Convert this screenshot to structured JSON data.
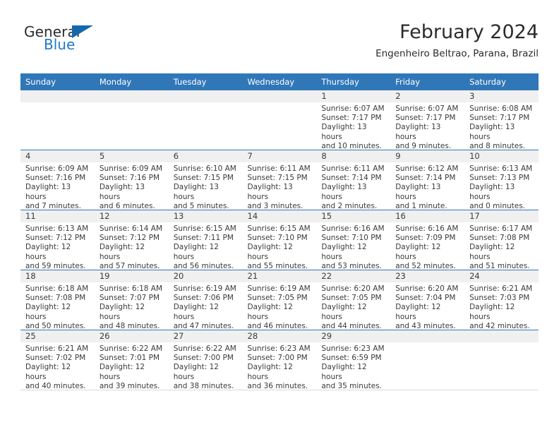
{
  "brand": {
    "word_general": "General",
    "word_blue": "Blue",
    "triangle_color": "#1668ad",
    "blue_text_color": "#1f7ac4"
  },
  "header": {
    "title": "February 2024",
    "subtitle": "Engenheiro Beltrao, Parana, Brazil",
    "header_bg": "#3077b8",
    "daynum_bg": "#f0f0f0"
  },
  "weekdays": [
    "Sunday",
    "Monday",
    "Tuesday",
    "Wednesday",
    "Thursday",
    "Friday",
    "Saturday"
  ],
  "weeks": [
    [
      {
        "day": "",
        "empty": true,
        "sunrise": "",
        "sunset": "",
        "daylight_a": "",
        "daylight_b": ""
      },
      {
        "day": "",
        "empty": true,
        "sunrise": "",
        "sunset": "",
        "daylight_a": "",
        "daylight_b": ""
      },
      {
        "day": "",
        "empty": true,
        "sunrise": "",
        "sunset": "",
        "daylight_a": "",
        "daylight_b": ""
      },
      {
        "day": "",
        "empty": true,
        "sunrise": "",
        "sunset": "",
        "daylight_a": "",
        "daylight_b": ""
      },
      {
        "day": "1",
        "empty": false,
        "sunrise": "Sunrise: 6:07 AM",
        "sunset": "Sunset: 7:17 PM",
        "daylight_a": "Daylight: 13 hours",
        "daylight_b": "and 10 minutes."
      },
      {
        "day": "2",
        "empty": false,
        "sunrise": "Sunrise: 6:07 AM",
        "sunset": "Sunset: 7:17 PM",
        "daylight_a": "Daylight: 13 hours",
        "daylight_b": "and 9 minutes."
      },
      {
        "day": "3",
        "empty": false,
        "sunrise": "Sunrise: 6:08 AM",
        "sunset": "Sunset: 7:17 PM",
        "daylight_a": "Daylight: 13 hours",
        "daylight_b": "and 8 minutes."
      }
    ],
    [
      {
        "day": "4",
        "empty": false,
        "sunrise": "Sunrise: 6:09 AM",
        "sunset": "Sunset: 7:16 PM",
        "daylight_a": "Daylight: 13 hours",
        "daylight_b": "and 7 minutes."
      },
      {
        "day": "5",
        "empty": false,
        "sunrise": "Sunrise: 6:09 AM",
        "sunset": "Sunset: 7:16 PM",
        "daylight_a": "Daylight: 13 hours",
        "daylight_b": "and 6 minutes."
      },
      {
        "day": "6",
        "empty": false,
        "sunrise": "Sunrise: 6:10 AM",
        "sunset": "Sunset: 7:15 PM",
        "daylight_a": "Daylight: 13 hours",
        "daylight_b": "and 5 minutes."
      },
      {
        "day": "7",
        "empty": false,
        "sunrise": "Sunrise: 6:11 AM",
        "sunset": "Sunset: 7:15 PM",
        "daylight_a": "Daylight: 13 hours",
        "daylight_b": "and 3 minutes."
      },
      {
        "day": "8",
        "empty": false,
        "sunrise": "Sunrise: 6:11 AM",
        "sunset": "Sunset: 7:14 PM",
        "daylight_a": "Daylight: 13 hours",
        "daylight_b": "and 2 minutes."
      },
      {
        "day": "9",
        "empty": false,
        "sunrise": "Sunrise: 6:12 AM",
        "sunset": "Sunset: 7:14 PM",
        "daylight_a": "Daylight: 13 hours",
        "daylight_b": "and 1 minute."
      },
      {
        "day": "10",
        "empty": false,
        "sunrise": "Sunrise: 6:13 AM",
        "sunset": "Sunset: 7:13 PM",
        "daylight_a": "Daylight: 13 hours",
        "daylight_b": "and 0 minutes."
      }
    ],
    [
      {
        "day": "11",
        "empty": false,
        "sunrise": "Sunrise: 6:13 AM",
        "sunset": "Sunset: 7:12 PM",
        "daylight_a": "Daylight: 12 hours",
        "daylight_b": "and 59 minutes."
      },
      {
        "day": "12",
        "empty": false,
        "sunrise": "Sunrise: 6:14 AM",
        "sunset": "Sunset: 7:12 PM",
        "daylight_a": "Daylight: 12 hours",
        "daylight_b": "and 57 minutes."
      },
      {
        "day": "13",
        "empty": false,
        "sunrise": "Sunrise: 6:15 AM",
        "sunset": "Sunset: 7:11 PM",
        "daylight_a": "Daylight: 12 hours",
        "daylight_b": "and 56 minutes."
      },
      {
        "day": "14",
        "empty": false,
        "sunrise": "Sunrise: 6:15 AM",
        "sunset": "Sunset: 7:10 PM",
        "daylight_a": "Daylight: 12 hours",
        "daylight_b": "and 55 minutes."
      },
      {
        "day": "15",
        "empty": false,
        "sunrise": "Sunrise: 6:16 AM",
        "sunset": "Sunset: 7:10 PM",
        "daylight_a": "Daylight: 12 hours",
        "daylight_b": "and 53 minutes."
      },
      {
        "day": "16",
        "empty": false,
        "sunrise": "Sunrise: 6:16 AM",
        "sunset": "Sunset: 7:09 PM",
        "daylight_a": "Daylight: 12 hours",
        "daylight_b": "and 52 minutes."
      },
      {
        "day": "17",
        "empty": false,
        "sunrise": "Sunrise: 6:17 AM",
        "sunset": "Sunset: 7:08 PM",
        "daylight_a": "Daylight: 12 hours",
        "daylight_b": "and 51 minutes."
      }
    ],
    [
      {
        "day": "18",
        "empty": false,
        "sunrise": "Sunrise: 6:18 AM",
        "sunset": "Sunset: 7:08 PM",
        "daylight_a": "Daylight: 12 hours",
        "daylight_b": "and 50 minutes."
      },
      {
        "day": "19",
        "empty": false,
        "sunrise": "Sunrise: 6:18 AM",
        "sunset": "Sunset: 7:07 PM",
        "daylight_a": "Daylight: 12 hours",
        "daylight_b": "and 48 minutes."
      },
      {
        "day": "20",
        "empty": false,
        "sunrise": "Sunrise: 6:19 AM",
        "sunset": "Sunset: 7:06 PM",
        "daylight_a": "Daylight: 12 hours",
        "daylight_b": "and 47 minutes."
      },
      {
        "day": "21",
        "empty": false,
        "sunrise": "Sunrise: 6:19 AM",
        "sunset": "Sunset: 7:05 PM",
        "daylight_a": "Daylight: 12 hours",
        "daylight_b": "and 46 minutes."
      },
      {
        "day": "22",
        "empty": false,
        "sunrise": "Sunrise: 6:20 AM",
        "sunset": "Sunset: 7:05 PM",
        "daylight_a": "Daylight: 12 hours",
        "daylight_b": "and 44 minutes."
      },
      {
        "day": "23",
        "empty": false,
        "sunrise": "Sunrise: 6:20 AM",
        "sunset": "Sunset: 7:04 PM",
        "daylight_a": "Daylight: 12 hours",
        "daylight_b": "and 43 minutes."
      },
      {
        "day": "24",
        "empty": false,
        "sunrise": "Sunrise: 6:21 AM",
        "sunset": "Sunset: 7:03 PM",
        "daylight_a": "Daylight: 12 hours",
        "daylight_b": "and 42 minutes."
      }
    ],
    [
      {
        "day": "25",
        "empty": false,
        "sunrise": "Sunrise: 6:21 AM",
        "sunset": "Sunset: 7:02 PM",
        "daylight_a": "Daylight: 12 hours",
        "daylight_b": "and 40 minutes."
      },
      {
        "day": "26",
        "empty": false,
        "sunrise": "Sunrise: 6:22 AM",
        "sunset": "Sunset: 7:01 PM",
        "daylight_a": "Daylight: 12 hours",
        "daylight_b": "and 39 minutes."
      },
      {
        "day": "27",
        "empty": false,
        "sunrise": "Sunrise: 6:22 AM",
        "sunset": "Sunset: 7:00 PM",
        "daylight_a": "Daylight: 12 hours",
        "daylight_b": "and 38 minutes."
      },
      {
        "day": "28",
        "empty": false,
        "sunrise": "Sunrise: 6:23 AM",
        "sunset": "Sunset: 7:00 PM",
        "daylight_a": "Daylight: 12 hours",
        "daylight_b": "and 36 minutes."
      },
      {
        "day": "29",
        "empty": false,
        "sunrise": "Sunrise: 6:23 AM",
        "sunset": "Sunset: 6:59 PM",
        "daylight_a": "Daylight: 12 hours",
        "daylight_b": "and 35 minutes."
      },
      {
        "day": "",
        "empty": true,
        "sunrise": "",
        "sunset": "",
        "daylight_a": "",
        "daylight_b": ""
      },
      {
        "day": "",
        "empty": true,
        "sunrise": "",
        "sunset": "",
        "daylight_a": "",
        "daylight_b": ""
      }
    ]
  ]
}
